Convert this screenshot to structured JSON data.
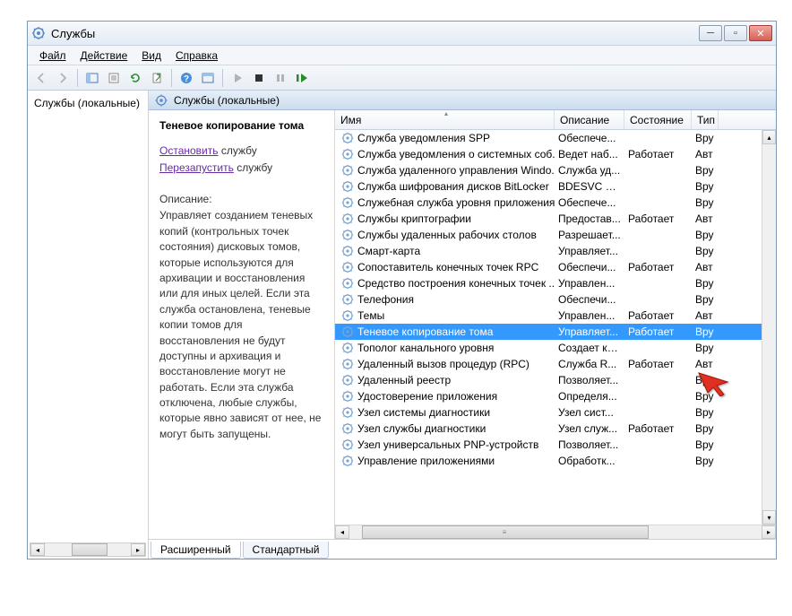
{
  "window": {
    "title": "Службы"
  },
  "menu": {
    "file": "Файл",
    "action": "Действие",
    "view": "Вид",
    "help": "Справка"
  },
  "tree": {
    "root": "Службы (локальные)"
  },
  "content": {
    "header": "Службы (локальные)"
  },
  "detail": {
    "service_name": "Теневое копирование тома",
    "stop_prefix": "Остановить",
    "stop_suffix": " службу",
    "restart_prefix": "Перезапустить",
    "restart_suffix": " службу",
    "desc_label": "Описание:",
    "desc_text": "Управляет созданием теневых копий (контрольных точек состояния) дисковых томов, которые используются для архивации и восстановления или для иных целей. Если эта служба остановлена, теневые копии томов для восстановления не будут доступны и архивация и восстановление могут не работать. Если эта служба отключена, любые службы, которые явно зависят от нее, не могут быть запущены."
  },
  "columns": {
    "name": "Имя",
    "desc": "Описание",
    "state": "Состояние",
    "type": "Тип"
  },
  "services": [
    {
      "name": "Служба уведомления SPP",
      "desc": "Обеспече...",
      "state": "",
      "type": "Вру"
    },
    {
      "name": "Служба уведомления о системных соб...",
      "desc": "Ведет наб...",
      "state": "Работает",
      "type": "Авт"
    },
    {
      "name": "Служба удаленного управления Windo...",
      "desc": "Служба уд...",
      "state": "",
      "type": "Вру"
    },
    {
      "name": "Служба шифрования дисков BitLocker",
      "desc": "BDESVC пр...",
      "state": "",
      "type": "Вру"
    },
    {
      "name": "Служебная служба уровня приложения",
      "desc": "Обеспече...",
      "state": "",
      "type": "Вру"
    },
    {
      "name": "Службы криптографии",
      "desc": "Предостав...",
      "state": "Работает",
      "type": "Авт"
    },
    {
      "name": "Службы удаленных рабочих столов",
      "desc": "Разрешает...",
      "state": "",
      "type": "Вру"
    },
    {
      "name": "Смарт-карта",
      "desc": "Управляет...",
      "state": "",
      "type": "Вру"
    },
    {
      "name": "Сопоставитель конечных точек RPC",
      "desc": "Обеспечи...",
      "state": "Работает",
      "type": "Авт"
    },
    {
      "name": "Средство построения конечных точек ...",
      "desc": "Управлен...",
      "state": "",
      "type": "Вру"
    },
    {
      "name": "Телефония",
      "desc": "Обеспечи...",
      "state": "",
      "type": "Вру"
    },
    {
      "name": "Темы",
      "desc": "Управлен...",
      "state": "Работает",
      "type": "Авт"
    },
    {
      "name": "Теневое копирование тома",
      "desc": "Управляет...",
      "state": "Работает",
      "type": "Вру",
      "selected": true
    },
    {
      "name": "Тополог канального уровня",
      "desc": "Создает ка...",
      "state": "",
      "type": "Вру"
    },
    {
      "name": "Удаленный вызов процедур (RPC)",
      "desc": "Служба R...",
      "state": "Работает",
      "type": "Авт"
    },
    {
      "name": "Удаленный реестр",
      "desc": "Позволяет...",
      "state": "",
      "type": "Вру"
    },
    {
      "name": "Удостоверение приложения",
      "desc": "Определя...",
      "state": "",
      "type": "Вру"
    },
    {
      "name": "Узел системы диагностики",
      "desc": "Узел сист...",
      "state": "",
      "type": "Вру"
    },
    {
      "name": "Узел службы диагностики",
      "desc": "Узел служ...",
      "state": "Работает",
      "type": "Вру"
    },
    {
      "name": "Узел универсальных PNP-устройств",
      "desc": "Позволяет...",
      "state": "",
      "type": "Вру"
    },
    {
      "name": "Управление приложениями",
      "desc": "Обработк...",
      "state": "",
      "type": "Вру"
    }
  ],
  "tabs": {
    "extended": "Расширенный",
    "standard": "Стандартный"
  }
}
